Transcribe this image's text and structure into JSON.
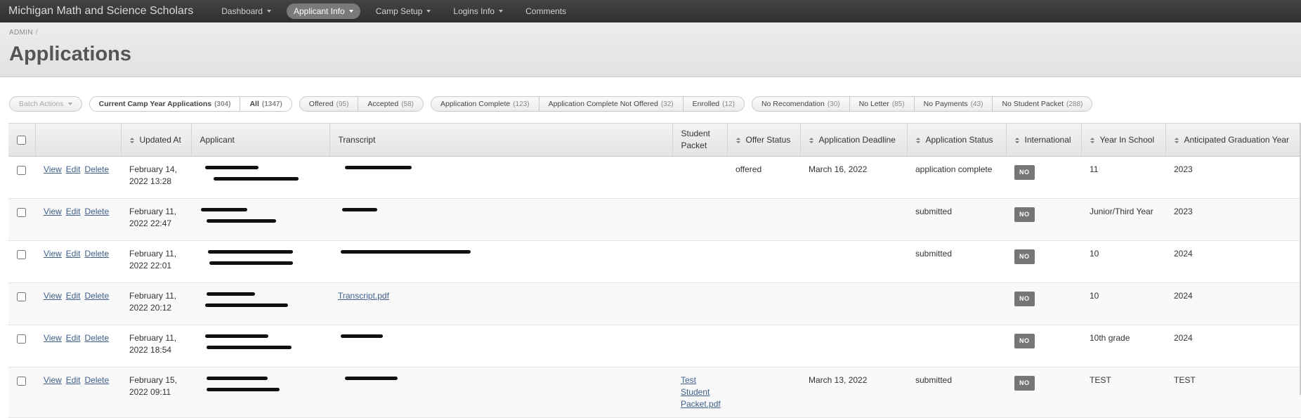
{
  "nav": {
    "brand": "Michigan Math and Science Scholars",
    "items": [
      {
        "label": "Dashboard",
        "dropdown": true,
        "active": false
      },
      {
        "label": "Applicant Info",
        "dropdown": true,
        "active": true
      },
      {
        "label": "Camp Setup",
        "dropdown": true,
        "active": false
      },
      {
        "label": "Logins Info",
        "dropdown": true,
        "active": false
      },
      {
        "label": "Comments",
        "dropdown": false,
        "active": false
      }
    ]
  },
  "header": {
    "breadcrumb": "ADMIN",
    "title": "Applications"
  },
  "filters": {
    "batch": "Batch Actions",
    "groups": [
      [
        {
          "label": "Current Camp Year Applications",
          "count": "(304)",
          "selected": true
        },
        {
          "label": "All",
          "count": "(1347)",
          "selected": true
        }
      ],
      [
        {
          "label": "Offered",
          "count": "(95)"
        },
        {
          "label": "Accepted",
          "count": "(58)"
        }
      ],
      [
        {
          "label": "Application Complete",
          "count": "(123)"
        },
        {
          "label": "Application Complete Not Offered",
          "count": "(32)"
        },
        {
          "label": "Enrolled",
          "count": "(12)"
        }
      ],
      [
        {
          "label": "No Recomendation",
          "count": "(30)"
        },
        {
          "label": "No Letter",
          "count": "(85)"
        },
        {
          "label": "No Payments",
          "count": "(43)"
        },
        {
          "label": "No Student Packet",
          "count": "(288)"
        }
      ]
    ]
  },
  "table": {
    "headers": {
      "updated_at": "Updated At",
      "applicant": "Applicant",
      "transcript": "Transcript",
      "student_packet": "Student Packet",
      "offer_status": "Offer Status",
      "deadline": "Application Deadline",
      "status": "Application Status",
      "international": "International",
      "year": "Year In School",
      "grad_year": "Anticipated Graduation Year"
    },
    "actions": {
      "view": "View",
      "edit": "Edit",
      "delete": "Delete"
    },
    "rows": [
      {
        "updated_1": "February 14,",
        "updated_2": "2022 13:28",
        "transcript": "",
        "packet": "",
        "offer": "offered",
        "deadline": "March 16, 2022",
        "status": "application complete",
        "intl": "NO",
        "year": "11",
        "grad": "2023"
      },
      {
        "updated_1": "February 11,",
        "updated_2": "2022 22:47",
        "transcript": "",
        "packet": "",
        "offer": "",
        "deadline": "",
        "status": "submitted",
        "intl": "NO",
        "year": "Junior/Third Year",
        "grad": "2023"
      },
      {
        "updated_1": "February 11,",
        "updated_2": "2022 22:01",
        "transcript": "",
        "packet": "",
        "offer": "",
        "deadline": "",
        "status": "submitted",
        "intl": "NO",
        "year": "10",
        "grad": "2024"
      },
      {
        "updated_1": "February 11,",
        "updated_2": "2022 20:12",
        "transcript": "Transcript.pdf",
        "packet": "",
        "offer": "",
        "deadline": "",
        "status": "",
        "intl": "NO",
        "year": "10",
        "grad": "2024"
      },
      {
        "updated_1": "February 11,",
        "updated_2": "2022 18:54",
        "transcript": "",
        "packet": "",
        "offer": "",
        "deadline": "",
        "status": "",
        "intl": "NO",
        "year": "10th grade",
        "grad": "2024"
      },
      {
        "updated_1": "February 15,",
        "updated_2": "2022 09:11",
        "transcript": "",
        "packet": "Test Student Packet.pdf",
        "offer": "",
        "deadline": "March 13, 2022",
        "status": "submitted",
        "intl": "NO",
        "year": "TEST",
        "grad": "TEST"
      }
    ]
  }
}
